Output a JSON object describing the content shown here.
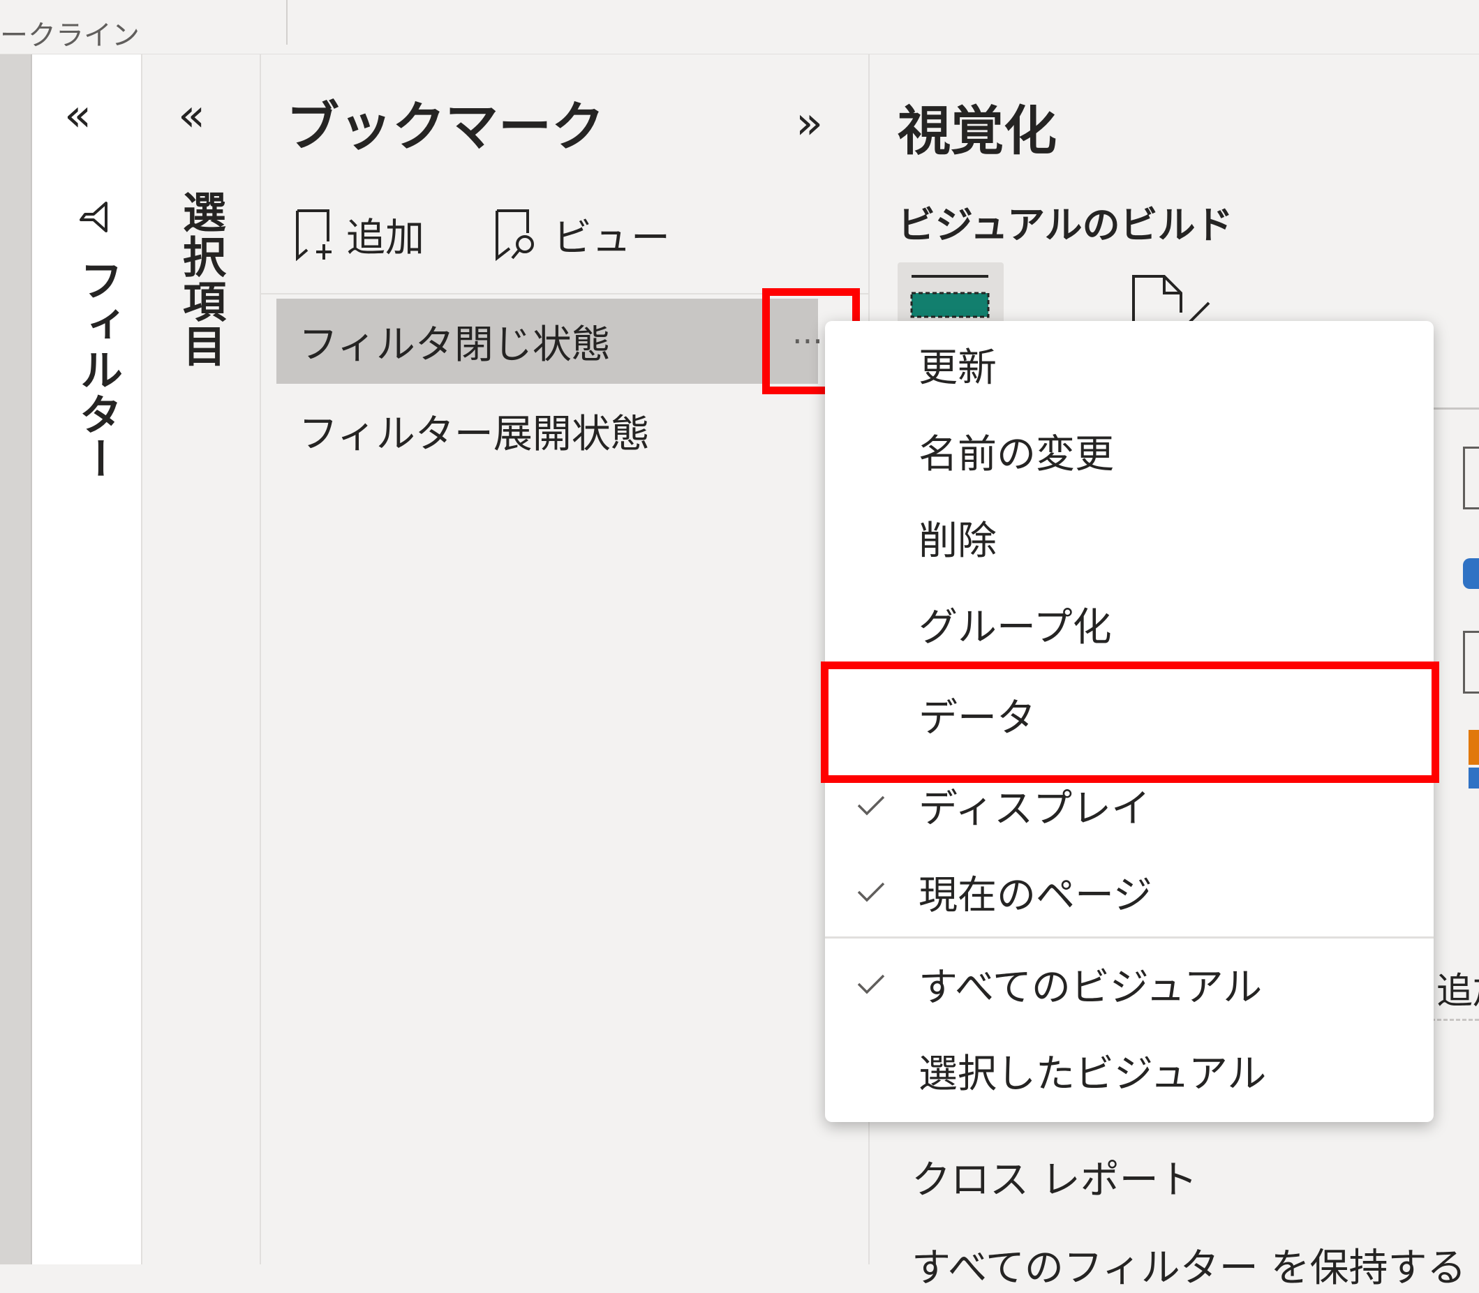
{
  "topbar": {
    "label": "ークライン"
  },
  "filters_pane": {
    "label": "フィルター",
    "collapse_glyph": "«",
    "funnel_icon": "filter-funnel-icon"
  },
  "selection_pane": {
    "label": "選択項目",
    "collapse_glyph": "«"
  },
  "bookmarks": {
    "title": "ブックマーク",
    "expand_glyph": "»",
    "add_label": "追加",
    "view_label": "ビュー",
    "items": [
      {
        "label": "フィルタ閉じ状態",
        "selected": true
      },
      {
        "label": "フィルター展開状態",
        "selected": false
      }
    ],
    "more_glyph": "···"
  },
  "visualizations": {
    "title": "視覚化",
    "build_label": "ビジュアルのビルド",
    "accent_color": "#127f6e",
    "cutoff_text": "追加",
    "cross_report": "クロス レポート",
    "keep_filters": "すべてのフィルター を保持する"
  },
  "context_menu": {
    "items": [
      {
        "label": "更新",
        "checked": false
      },
      {
        "label": "名前の変更",
        "checked": false
      },
      {
        "label": "削除",
        "checked": false
      },
      {
        "label": "グループ化",
        "checked": false
      },
      {
        "label": "データ",
        "checked": false,
        "highlighted": true
      },
      {
        "label": "ディスプレイ",
        "checked": true
      },
      {
        "label": "現在のページ",
        "checked": true
      },
      {
        "label": "すべてのビジュアル",
        "checked": true
      },
      {
        "label": "選択したビジュアル",
        "checked": false
      }
    ],
    "highlight_color": "#ff0000"
  }
}
